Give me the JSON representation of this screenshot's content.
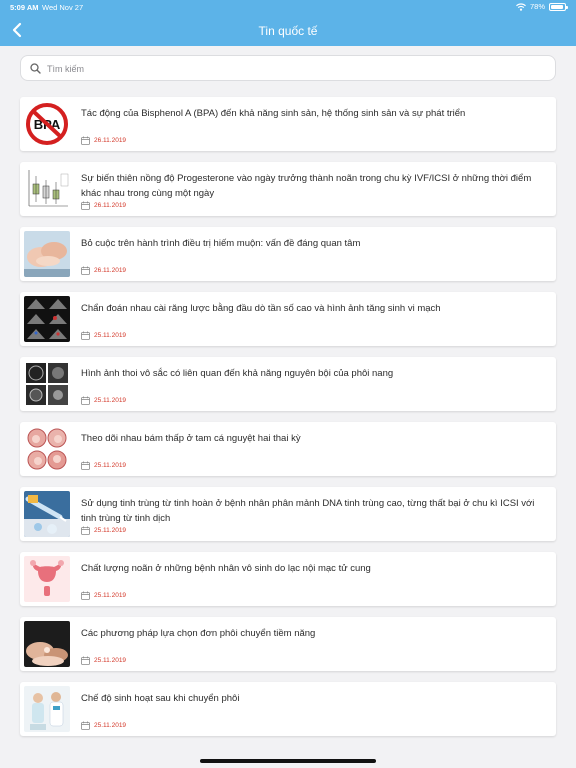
{
  "status": {
    "time": "5:09 AM",
    "date": "Wed Nov 27",
    "battery": "78%",
    "battery_level": 0.78
  },
  "header": {
    "title": "Tin quốc tế"
  },
  "search": {
    "placeholder": "Tìm kiếm"
  },
  "articles": [
    {
      "title": "Tác động của Bisphenol A (BPA) đến khả năng sinh sản, hệ thống sinh sản và sự phát triển",
      "date": "26.11.2019",
      "thumb": "bpa",
      "thumb_text": "BPA"
    },
    {
      "title": "Sự biến thiên nồng độ Progesterone vào ngày trưởng thành noãn trong chu kỳ IVF/ICSI ở những thời điểm khác nhau trong cùng một ngày",
      "date": "26.11.2019",
      "thumb": "boxplot"
    },
    {
      "title": "Bỏ cuộc trên hành trình điều trị hiếm muộn: vấn đề đáng quan tâm",
      "date": "26.11.2019",
      "thumb": "hands"
    },
    {
      "title": "Chẩn đoán nhau cài răng lược bằng đầu dò tần số cao và hình ảnh tăng sinh vi mạch",
      "date": "25.11.2019",
      "thumb": "ultrasound-grid"
    },
    {
      "title": "Hình ảnh thoi vô sắc có liên quan đến khả năng nguyên bội của phôi nang",
      "date": "25.11.2019",
      "thumb": "embryo-scan"
    },
    {
      "title": "Theo dõi nhau bám thấp ở tam cá nguyệt hai thai kỳ",
      "date": "25.11.2019",
      "thumb": "placenta"
    },
    {
      "title": "Sử dụng tinh trùng từ tinh hoàn ở bệnh nhân phân mảnh DNA tinh trùng cao, từng thất bại ở chu kì ICSI với tinh trùng từ tinh dịch",
      "date": "25.11.2019",
      "thumb": "lab-pipette"
    },
    {
      "title": "Chất lượng noãn ở những bệnh nhân vô sinh do lạc nội mạc tử cung",
      "date": "25.11.2019",
      "thumb": "uterus"
    },
    {
      "title": "Các phương pháp lựa chọn đơn phôi chuyển tiềm năng",
      "date": "25.11.2019",
      "thumb": "hands-dark"
    },
    {
      "title": "Chế độ sinh hoạt sau khi chuyển phôi",
      "date": "25.11.2019",
      "thumb": "doctor-patient"
    }
  ]
}
